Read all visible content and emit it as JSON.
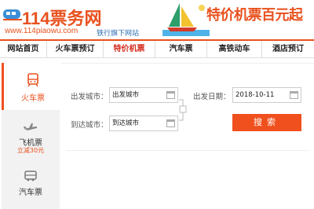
{
  "header": {
    "logo_text": "114票务网",
    "logo_url": "www.114piaowu.com",
    "logo_slogan": "铁行旗下网站",
    "banner_text": "特价机票百元起",
    "accent_color": "#e8511e"
  },
  "nav": {
    "items": [
      {
        "label": "网站首页",
        "active": false
      },
      {
        "label": "火车票预订",
        "active": false
      },
      {
        "label": "特价机票",
        "active": true
      },
      {
        "label": "汽车票",
        "active": false
      },
      {
        "label": "高铁动车",
        "active": false
      },
      {
        "label": "酒店预订",
        "active": false
      }
    ]
  },
  "tabs": {
    "train": {
      "label": "火车票",
      "icon": "train-icon"
    },
    "flight": {
      "label": "飞机票",
      "promo": "立减30元",
      "icon": "plane-icon"
    },
    "bus": {
      "label": "汽车票",
      "icon": "bus-icon"
    }
  },
  "form": {
    "from_label": "出发城市：",
    "from_placeholder": "出发城市",
    "to_label": "到达城市：",
    "to_placeholder": "到达城市",
    "date_label": "出发日期：",
    "date_value": "2018-10-11",
    "search_label": "搜索"
  }
}
